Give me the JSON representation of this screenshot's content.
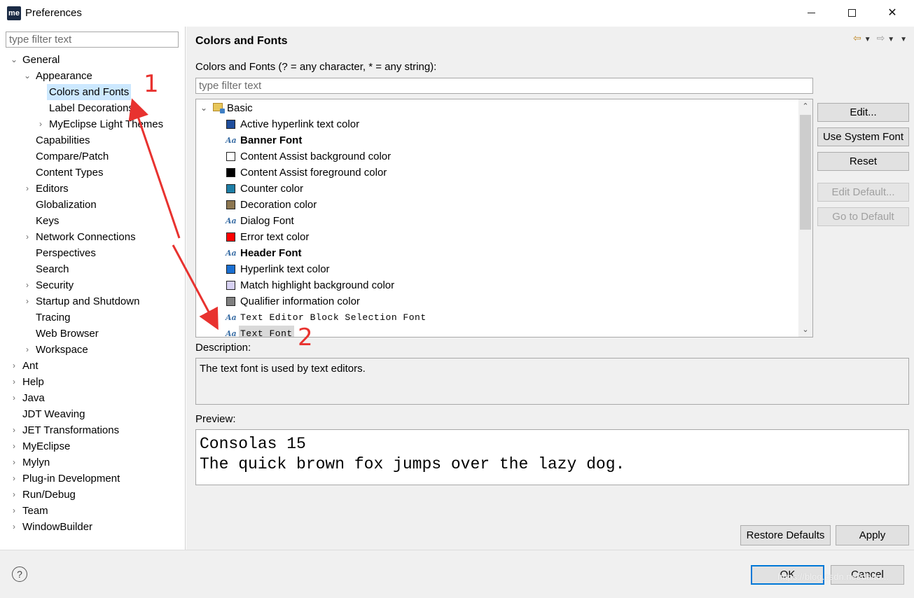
{
  "window": {
    "title": "Preferences",
    "app_icon_text": "me"
  },
  "left": {
    "filter_placeholder": "type filter text",
    "tree": [
      {
        "label": "General",
        "arrow": "⌄"
      },
      {
        "label": "Appearance",
        "arrow": "⌄"
      },
      {
        "label": "Colors and Fonts",
        "arrow": ""
      },
      {
        "label": "Label Decorations",
        "arrow": ""
      },
      {
        "label": "MyEclipse Light Themes",
        "arrow": "›"
      },
      {
        "label": "Capabilities",
        "arrow": ""
      },
      {
        "label": "Compare/Patch",
        "arrow": ""
      },
      {
        "label": "Content Types",
        "arrow": ""
      },
      {
        "label": "Editors",
        "arrow": "›"
      },
      {
        "label": "Globalization",
        "arrow": ""
      },
      {
        "label": "Keys",
        "arrow": ""
      },
      {
        "label": "Network Connections",
        "arrow": "›"
      },
      {
        "label": "Perspectives",
        "arrow": ""
      },
      {
        "label": "Search",
        "arrow": ""
      },
      {
        "label": "Security",
        "arrow": "›"
      },
      {
        "label": "Startup and Shutdown",
        "arrow": "›"
      },
      {
        "label": "Tracing",
        "arrow": ""
      },
      {
        "label": "Web Browser",
        "arrow": ""
      },
      {
        "label": "Workspace",
        "arrow": "›"
      },
      {
        "label": "Ant",
        "arrow": "›"
      },
      {
        "label": "Help",
        "arrow": "›"
      },
      {
        "label": "Java",
        "arrow": "›"
      },
      {
        "label": "JDT Weaving",
        "arrow": ""
      },
      {
        "label": "JET Transformations",
        "arrow": "›"
      },
      {
        "label": "MyEclipse",
        "arrow": "›"
      },
      {
        "label": "Mylyn",
        "arrow": "›"
      },
      {
        "label": "Plug-in Development",
        "arrow": "›"
      },
      {
        "label": "Run/Debug",
        "arrow": "›"
      },
      {
        "label": "Team",
        "arrow": "›"
      },
      {
        "label": "WindowBuilder",
        "arrow": "›"
      }
    ]
  },
  "main": {
    "title": "Colors and Fonts",
    "filter_label": "Colors and Fonts (? = any character, * = any string):",
    "filter_placeholder": "type filter text",
    "category": "Basic",
    "items": [
      {
        "label": "Active hyperlink text color",
        "color": "#1f4e9c"
      },
      {
        "label": "Banner Font"
      },
      {
        "label": "Content Assist background color",
        "color": "#ffffff"
      },
      {
        "label": "Content Assist foreground color",
        "color": "#000000"
      },
      {
        "label": "Counter color",
        "color": "#1d7ea6"
      },
      {
        "label": "Decoration color",
        "color": "#8c7650"
      },
      {
        "label": "Dialog Font"
      },
      {
        "label": "Error text color",
        "color": "#ff0000"
      },
      {
        "label": "Header Font"
      },
      {
        "label": "Hyperlink text color",
        "color": "#1a6fd1"
      },
      {
        "label": "Match highlight background color",
        "color": "#d7d1f3"
      },
      {
        "label": "Qualifier information color",
        "color": "#7f7f7f"
      },
      {
        "label": "Text Editor Block Selection Font"
      },
      {
        "label": "Text Font"
      }
    ],
    "font_icon_glyph": "Aa",
    "buttons": {
      "edit": "Edit...",
      "use_system_font": "Use System Font",
      "reset": "Reset",
      "edit_default": "Edit Default...",
      "go_to_default": "Go to Default"
    },
    "description_label": "Description:",
    "description_text": "The text font is used by text editors.",
    "preview_label": "Preview:",
    "preview_line1": "Consolas 15",
    "preview_line2": "The quick brown fox jumps over the lazy dog.",
    "restore_defaults": "Restore Defaults",
    "apply": "Apply"
  },
  "footer": {
    "help_glyph": "?",
    "ok": "OK",
    "cancel": "Cancel",
    "watermark": "https://blog.csdn.net/daitu..."
  },
  "annotations": {
    "label1": "1",
    "label2": "2",
    "color": "#e8322f"
  }
}
